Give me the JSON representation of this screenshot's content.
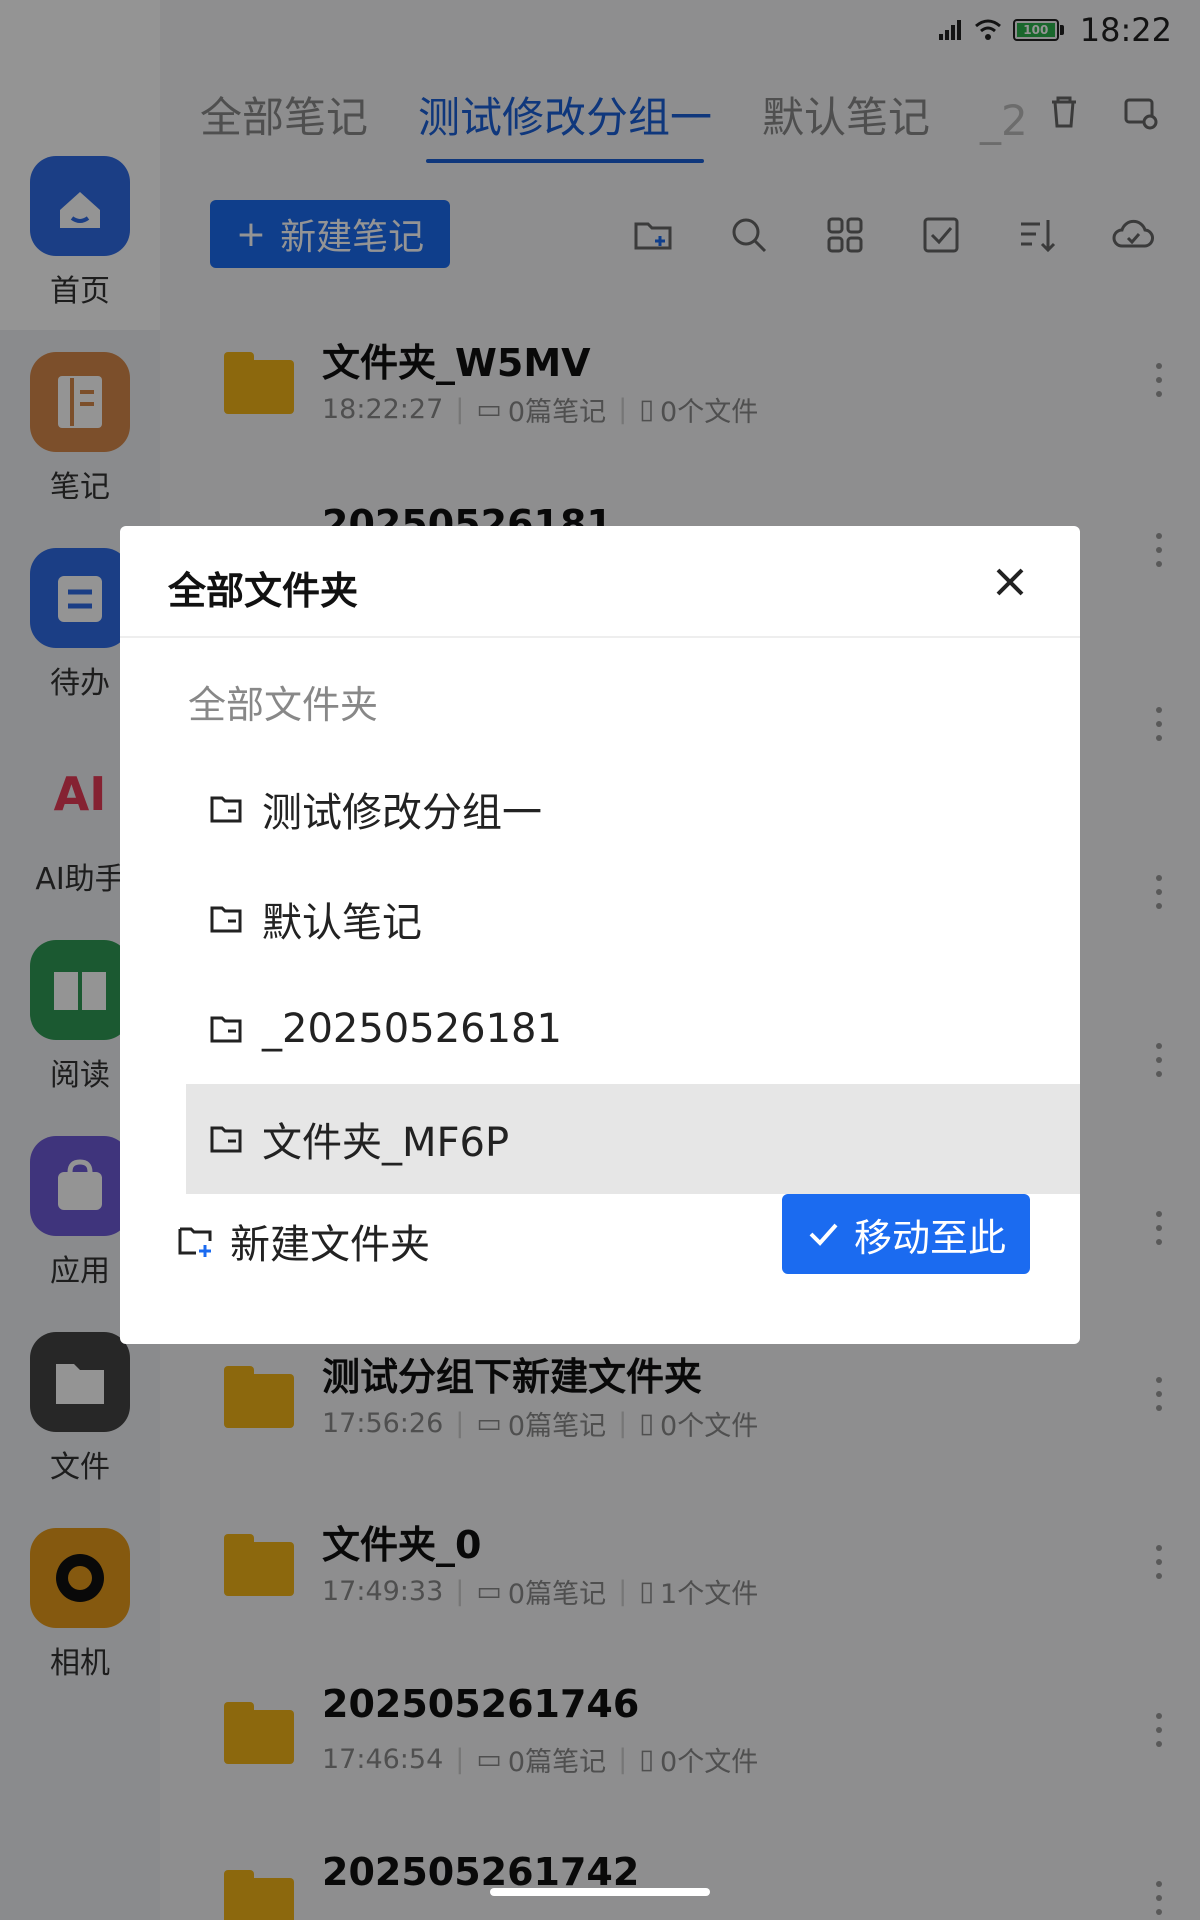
{
  "status_bar": {
    "time": "18:22",
    "battery": "100"
  },
  "dock": {
    "items": [
      {
        "label": "首页",
        "icon": "home-icon",
        "color": "#2f6be6"
      },
      {
        "label": "笔记",
        "icon": "notebook-icon",
        "color": "#d6884a"
      },
      {
        "label": "待办",
        "icon": "todo-icon",
        "color": "#2f6be6"
      },
      {
        "label": "AI助手",
        "icon": "ai-icon",
        "text": "AI"
      },
      {
        "label": "阅读",
        "icon": "reading-icon",
        "color": "#2f9a55"
      },
      {
        "label": "应用",
        "icon": "apps-icon",
        "color": "#6d5ad6"
      },
      {
        "label": "文件",
        "icon": "files-icon",
        "color": "#444444"
      },
      {
        "label": "相机",
        "icon": "camera-icon",
        "color": "#e69a1a"
      }
    ]
  },
  "tabs": {
    "items": [
      "全部笔记",
      "测试修改分组一",
      "默认笔记"
    ],
    "active_index": 1,
    "overflow": "_2"
  },
  "toolbar": {
    "new_note_label": "新建笔记"
  },
  "list": {
    "items": [
      {
        "title": "文件夹_W5MV",
        "time": "18:22:27",
        "notes": "0篇笔记",
        "files": "0个文件"
      },
      {
        "title": "20250526181"
      },
      {
        "title": "测试分组下新建文件夹",
        "time": "17:56:26",
        "notes": "0篇笔记",
        "files": "0个文件"
      },
      {
        "title": "文件夹_0",
        "time": "17:49:33",
        "notes": "0篇笔记",
        "files": "1个文件"
      },
      {
        "title": "202505261746",
        "time": "17:46:54",
        "notes": "0篇笔记",
        "files": "0个文件"
      },
      {
        "title": "202505261742"
      }
    ]
  },
  "dialog": {
    "title": "全部文件夹",
    "root_label": "全部文件夹",
    "folders": [
      "测试修改分组一",
      "默认笔记",
      "_20250526181",
      "文件夹_MF6P"
    ],
    "selected_index": 3,
    "new_folder_label": "新建文件夹",
    "move_button_label": "移动至此"
  },
  "colors": {
    "accent": "#1b6bf0",
    "folder": "#f2b318"
  }
}
